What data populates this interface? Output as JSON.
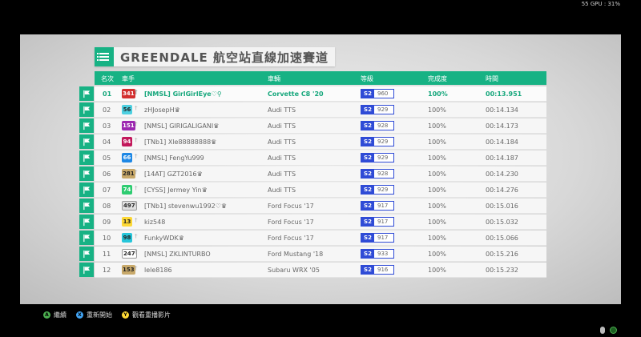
{
  "overlay": {
    "fps_text": "55 GPU : 31%"
  },
  "header": {
    "title": "GREENDALE 航空站直線加速賽道"
  },
  "columns": {
    "position": "名次",
    "driver": "車手",
    "car": "車輛",
    "class": "等級",
    "completion": "完成度",
    "time": "時間"
  },
  "rows": [
    {
      "pos": "01",
      "badge": "341",
      "badge_bg": "#d32f2f",
      "badge_fg": "#ffffff",
      "driver": "[NMSL] GirlGirlEye♡⚲",
      "car": "Corvette C8 '20",
      "class": "S2",
      "pi": "960",
      "completion": "100%",
      "time": "00:13.951",
      "me": true
    },
    {
      "pos": "02",
      "badge": "56",
      "badge_bg": "#4dd0e1",
      "badge_fg": "#222222",
      "driver": "zHJosepH♛",
      "car": "Audi TTS",
      "class": "S2",
      "pi": "929",
      "completion": "100%",
      "time": "00:14.134"
    },
    {
      "pos": "03",
      "badge": "151",
      "badge_bg": "#9c27b0",
      "badge_fg": "#ffffff",
      "driver": "[NMSL] GIRIGALIGANI♛",
      "car": "Audi TTS",
      "class": "S2",
      "pi": "928",
      "completion": "100%",
      "time": "00:14.173"
    },
    {
      "pos": "04",
      "badge": "94",
      "badge_bg": "#c2185b",
      "badge_fg": "#ffffff",
      "driver": "[TNb1] Xle88888888♛",
      "car": "Audi TTS",
      "class": "S2",
      "pi": "929",
      "completion": "100%",
      "time": "00:14.184"
    },
    {
      "pos": "05",
      "badge": "66",
      "badge_bg": "#1e88e5",
      "badge_fg": "#ffffff",
      "driver": "[NMSL] FengYu999",
      "car": "Audi TTS",
      "class": "S2",
      "pi": "929",
      "completion": "100%",
      "time": "00:14.187"
    },
    {
      "pos": "06",
      "badge": "281",
      "badge_bg": "#c8a96a",
      "badge_fg": "#222222",
      "driver": "[14AT] GZT2016♛",
      "car": "Audi TTS",
      "class": "S2",
      "pi": "928",
      "completion": "100%",
      "time": "00:14.230"
    },
    {
      "pos": "07",
      "badge": "74",
      "badge_bg": "#2ecc71",
      "badge_fg": "#ffffff",
      "driver": "[CYSS] Jermey Yin♛",
      "car": "Audi TTS",
      "class": "S2",
      "pi": "929",
      "completion": "100%",
      "time": "00:14.276"
    },
    {
      "pos": "08",
      "badge": "497",
      "badge_bg": "#e0e0e0",
      "badge_fg": "#222222",
      "driver": "[TNb1] stevenwu1992♡♛",
      "car": "Ford Focus '17",
      "class": "S2",
      "pi": "917",
      "completion": "100%",
      "time": "00:15.016"
    },
    {
      "pos": "09",
      "badge": "13",
      "badge_bg": "#fdd835",
      "badge_fg": "#222222",
      "driver": "kiz548",
      "car": "Ford Focus '17",
      "class": "S2",
      "pi": "917",
      "completion": "100%",
      "time": "00:15.032"
    },
    {
      "pos": "10",
      "badge": "98",
      "badge_bg": "#26c6da",
      "badge_fg": "#222222",
      "driver": "FunkyWDK♛",
      "car": "Ford Focus '17",
      "class": "S2",
      "pi": "917",
      "completion": "100%",
      "time": "00:15.066"
    },
    {
      "pos": "11",
      "badge": "247",
      "badge_bg": "#ffffff",
      "badge_fg": "#222222",
      "driver": "[NMSL] ZKLINTURBO",
      "car": "Ford Mustang '18",
      "class": "S2",
      "pi": "933",
      "completion": "100%",
      "time": "00:15.216"
    },
    {
      "pos": "12",
      "badge": "153",
      "badge_bg": "#c8a96a",
      "badge_fg": "#222222",
      "driver": "lele8186",
      "car": "Subaru WRX '05",
      "class": "S2",
      "pi": "916",
      "completion": "100%",
      "time": "00:15.232"
    }
  ],
  "footer": [
    {
      "key": "A",
      "label": "繼續",
      "color": "#4caf50"
    },
    {
      "key": "X",
      "label": "重新開始",
      "color": "#42a5f5"
    },
    {
      "key": "Y",
      "label": "觀看重播影片",
      "color": "#fdd835"
    }
  ]
}
